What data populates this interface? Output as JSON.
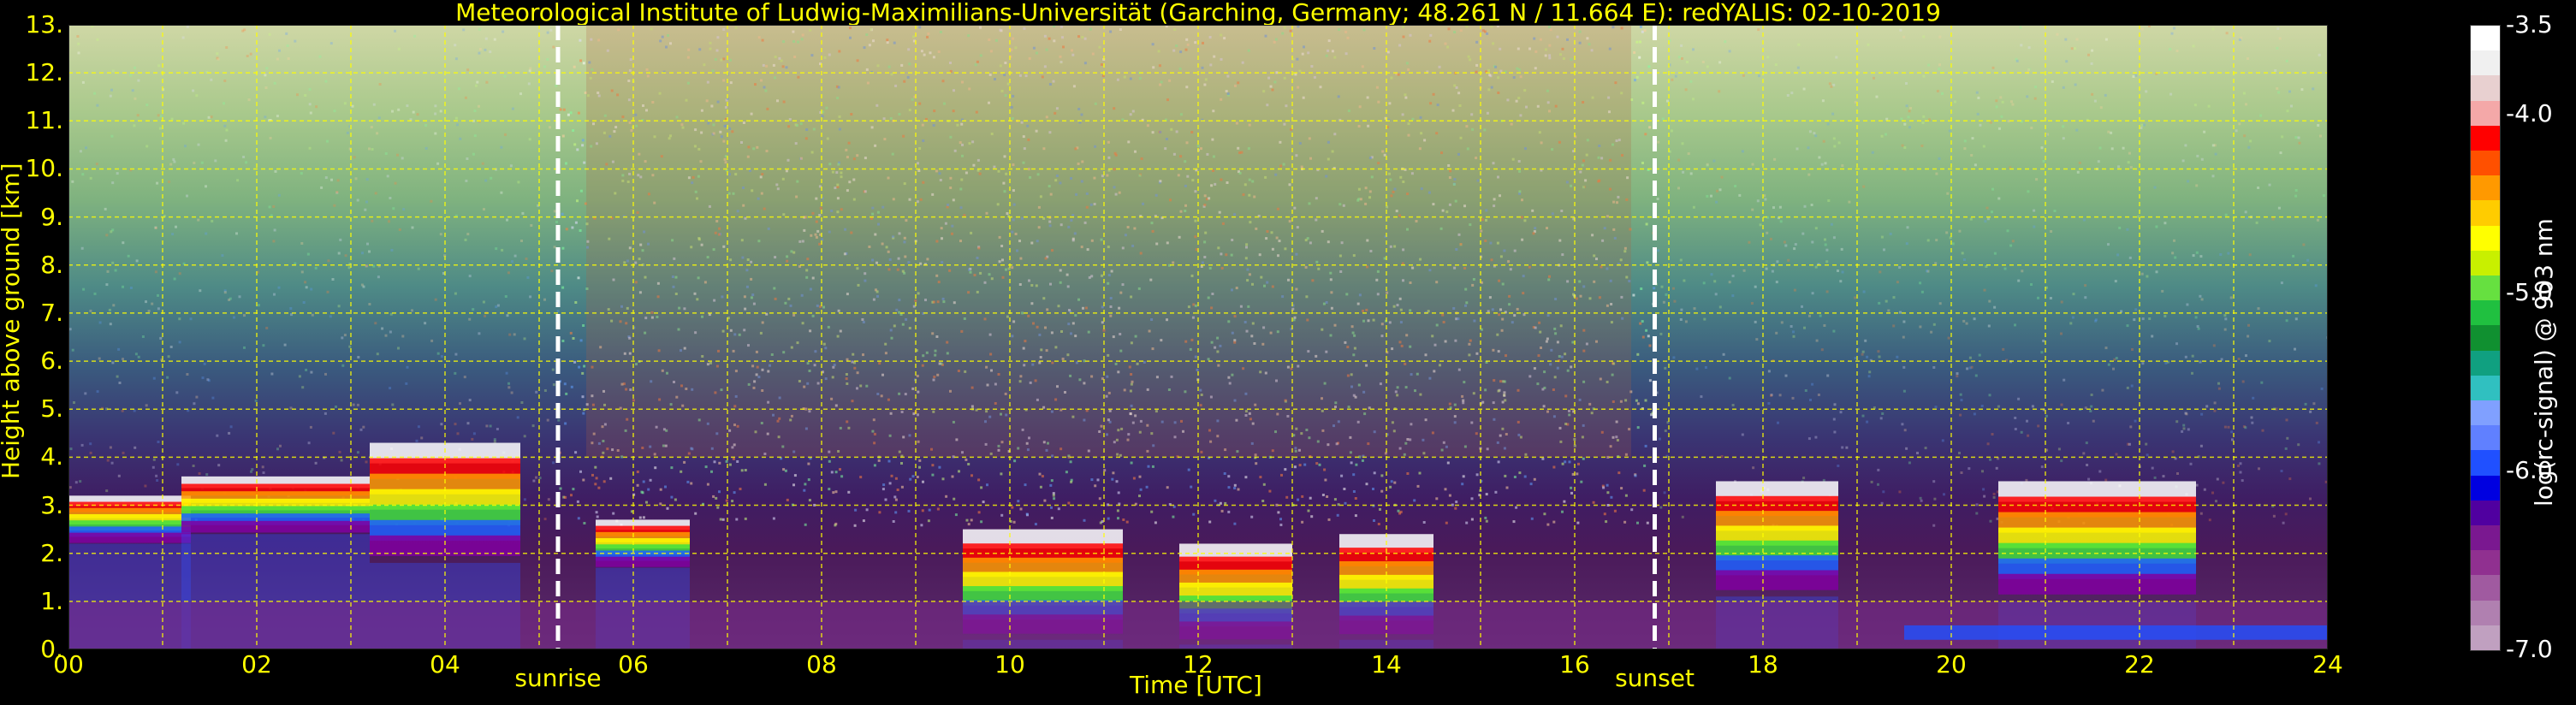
{
  "title": "Meteorological Institute of Ludwig-Maximilians-Universität (Garching, Germany; 48.261 N / 11.664 E):    redYALIS: 02-10-2019",
  "chart_data": {
    "type": "heatmap",
    "title": "Meteorological Institute of Ludwig-Maximilians-Universität (Garching, Germany; 48.261 N / 11.664 E):    redYALIS: 02-10-2019",
    "xlabel": "Time [UTC]",
    "ylabel": "Height above ground [km]",
    "xlim": [
      0,
      24
    ],
    "ylim": [
      0,
      13
    ],
    "x_ticks": [
      "00",
      "02",
      "04",
      "06",
      "08",
      "10",
      "12",
      "14",
      "16",
      "18",
      "20",
      "22",
      "24"
    ],
    "x_tick_values": [
      0,
      2,
      4,
      6,
      8,
      10,
      12,
      14,
      16,
      18,
      20,
      22,
      24
    ],
    "y_ticks": [
      "0.",
      "1.",
      "2.",
      "3.",
      "4.",
      "5.",
      "6.",
      "7.",
      "8.",
      "9.",
      "10.",
      "11.",
      "12.",
      "13."
    ],
    "y_tick_values": [
      0,
      1,
      2,
      3,
      4,
      5,
      6,
      7,
      8,
      9,
      10,
      11,
      12,
      13
    ],
    "grid": true,
    "grid_color": "#ffff00",
    "events": [
      {
        "label": "sunrise",
        "time": 5.2
      },
      {
        "label": "sunset",
        "time": 16.85
      }
    ],
    "colorbar": {
      "label": "log(rc-signal) @ 903 nm",
      "range": [
        -7.0,
        -3.5
      ],
      "ticks": [
        "-3.5",
        "-4.0",
        "-5.0",
        "-6.0",
        "-7.0"
      ],
      "tick_values": [
        -3.5,
        -4.0,
        -5.0,
        -6.0,
        -7.0
      ],
      "colors": [
        "#ffffff",
        "#f0f0f0",
        "#e8d0d0",
        "#f4a8a8",
        "#ff0000",
        "#ff5000",
        "#ff9900",
        "#ffcc00",
        "#ffff00",
        "#c8f000",
        "#66e040",
        "#20c040",
        "#109030",
        "#10a080",
        "#30c0c0",
        "#80a0ff",
        "#6080ff",
        "#2050ff",
        "#0000e0",
        "#5000a0",
        "#7a1890",
        "#903090",
        "#a05aa0",
        "#b080b0",
        "#c0a0c0"
      ]
    },
    "cloud_layers": [
      {
        "t_start": 0.0,
        "t_end": 1.3,
        "base_km": 2.2,
        "top_km": 3.2
      },
      {
        "t_start": 1.2,
        "t_end": 3.2,
        "base_km": 2.4,
        "top_km": 3.6
      },
      {
        "t_start": 3.2,
        "t_end": 4.8,
        "base_km": 1.8,
        "top_km": 4.3
      },
      {
        "t_start": 5.6,
        "t_end": 6.6,
        "base_km": 1.7,
        "top_km": 2.7
      },
      {
        "t_start": 9.5,
        "t_end": 11.2,
        "base_km": 0.2,
        "top_km": 2.5
      },
      {
        "t_start": 11.8,
        "t_end": 13.0,
        "base_km": 0.1,
        "top_km": 2.2
      },
      {
        "t_start": 13.5,
        "t_end": 14.5,
        "base_km": 0.2,
        "top_km": 2.4
      },
      {
        "t_start": 17.5,
        "t_end": 18.8,
        "base_km": 1.1,
        "top_km": 3.5
      },
      {
        "t_start": 20.5,
        "t_end": 22.6,
        "base_km": 1.0,
        "top_km": 3.5
      }
    ]
  }
}
